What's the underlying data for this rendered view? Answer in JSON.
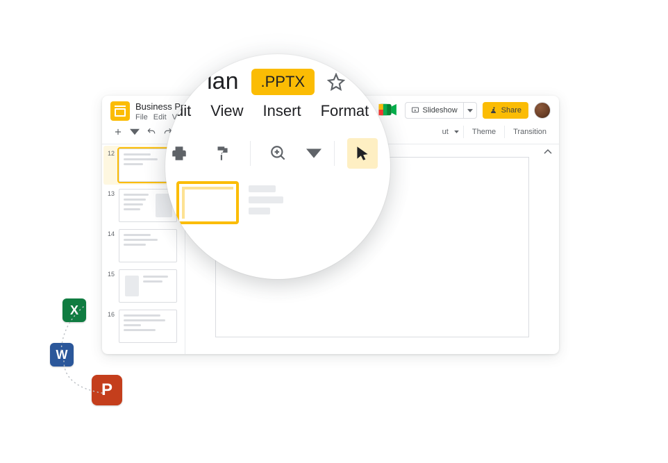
{
  "doc": {
    "title": "Business Proposal",
    "title_truncated": "Business Prop",
    "full_title_visible": "ss Plan",
    "badge": ".PPTX"
  },
  "menus": {
    "file": "File",
    "edit": "Edit",
    "view": "View",
    "insert": "Insert",
    "format": "Format"
  },
  "menus_truncated": {
    "view": "Vie",
    "edit": "dit"
  },
  "header": {
    "slideshow": "Slideshow",
    "share": "Share"
  },
  "toolbar_text": {
    "layout_truncated": "ut",
    "theme": "Theme",
    "transition": "Transition"
  },
  "thumbs": [
    {
      "num": "12",
      "active": true
    },
    {
      "num": "13",
      "active": false
    },
    {
      "num": "14",
      "active": false
    },
    {
      "num": "15",
      "active": false
    },
    {
      "num": "16",
      "active": false
    }
  ],
  "apps": {
    "excel": "X",
    "word": "W",
    "powerpoint": "P"
  }
}
